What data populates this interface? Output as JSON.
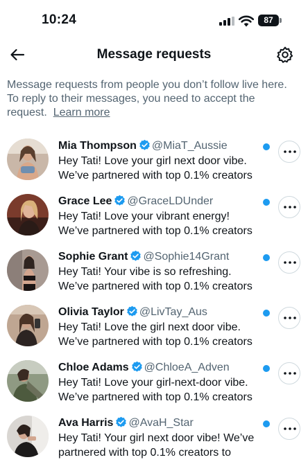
{
  "status_bar": {
    "time": "10:24",
    "battery": "87",
    "icons": [
      "signal-icon",
      "wifi-icon",
      "battery-icon"
    ]
  },
  "header": {
    "title": "Message requests",
    "back_icon": "arrow-left-icon",
    "settings_icon": "gear-icon"
  },
  "info": {
    "text": "Message requests from people you don’t follow live here. To reply to their messages, you need to accept the request.",
    "learn_more": "Learn more"
  },
  "colors": {
    "accent": "#1d9bf0",
    "text_primary": "#0f1419",
    "text_secondary": "#536471"
  },
  "requests": [
    {
      "name": "Mia Thompson",
      "handle": "@MiaT_Aussie",
      "line1": "Hey Tati! Love your girl next door vibe.",
      "line2": "We’ve partnered with top 0.1% creators",
      "verified": true,
      "unread": true
    },
    {
      "name": "Grace Lee",
      "handle": "@GraceLDUnder",
      "line1": "Hey Tati! Love your vibrant energy!",
      "line2": "We’ve partnered with top 0.1% creators",
      "verified": true,
      "unread": true
    },
    {
      "name": "Sophie Grant",
      "handle": "@Sophie14Grant",
      "line1": "Hey Tati! Your vibe is so refreshing.",
      "line2": "We’ve partnered with top 0.1% creators",
      "verified": true,
      "unread": true
    },
    {
      "name": "Olivia Taylor",
      "handle": "@LivTay_Aus",
      "line1": "Hey Tati! Love the girl next door vibe.",
      "line2": "We’ve partnered with top 0.1% creators",
      "verified": true,
      "unread": true
    },
    {
      "name": "Chloe Adams",
      "handle": "@ChloeA_Adven",
      "line1": "Hey Tati! Love your girl-next-door vibe.",
      "line2": "We’ve partnered with top 0.1% creators",
      "verified": true,
      "unread": true
    },
    {
      "name": "Ava Harris",
      "handle": "@AvaH_Star",
      "line1": "Hey Tati! Your girl next door vibe! We’ve",
      "line2": "partnered with top 0.1% creators to",
      "verified": true,
      "unread": true
    }
  ]
}
